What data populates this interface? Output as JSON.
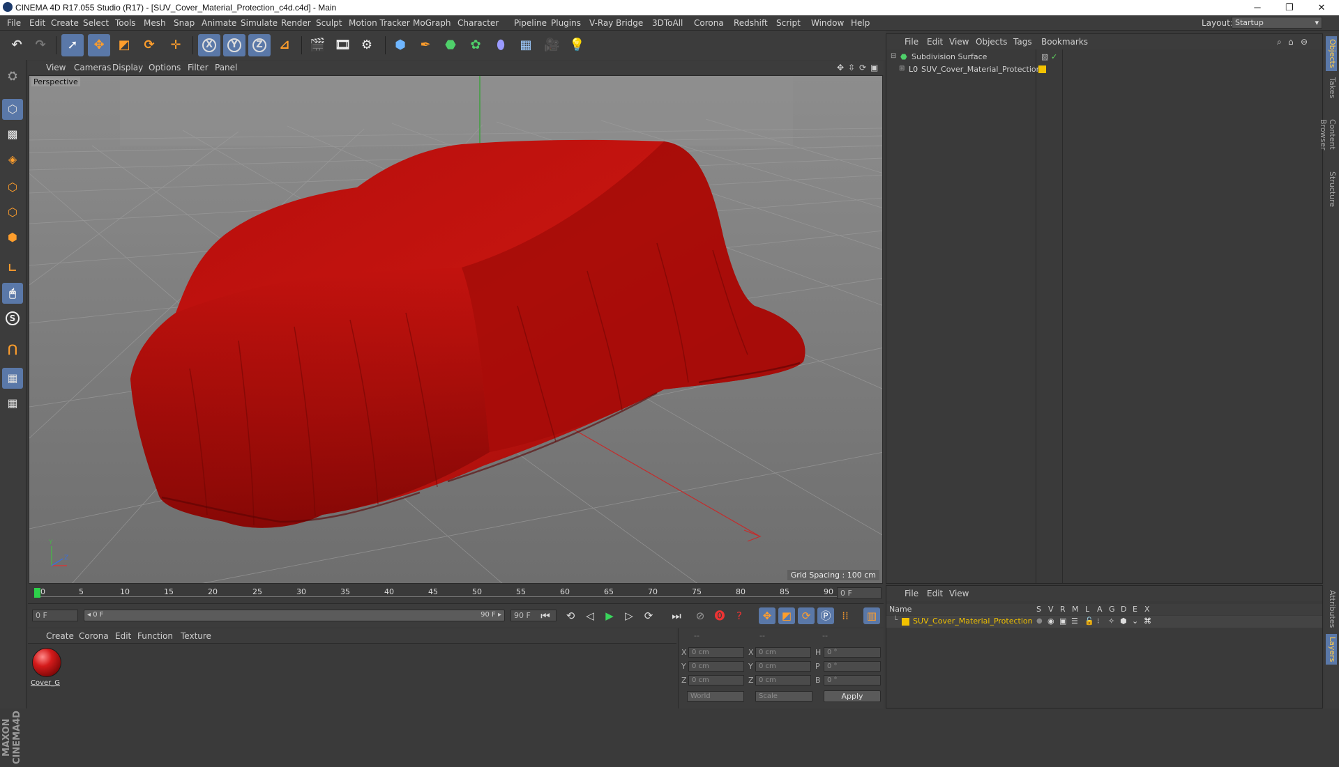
{
  "window": {
    "title": "CINEMA 4D R17.055 Studio (R17) - [SUV_Cover_Material_Protection_c4d.c4d] - Main",
    "minimize": "─",
    "restore": "❐",
    "close": "✕"
  },
  "menubar": {
    "items": [
      "File",
      "Edit",
      "Create",
      "Select",
      "Tools",
      "Mesh",
      "Snap",
      "Animate",
      "Simulate",
      "Render",
      "Sculpt",
      "Motion Tracker",
      "MoGraph",
      "Character",
      "Pipeline",
      "Plugins",
      "V-Ray Bridge",
      "3DToAll",
      "Corona",
      "Redshift",
      "Script",
      "Window",
      "Help"
    ],
    "layout_label": "Layout:",
    "layout_value": "Startup"
  },
  "toolbar": {
    "axis_x": "X",
    "axis_y": "Y",
    "axis_z": "Z"
  },
  "viewport": {
    "menu": [
      "View",
      "Cameras",
      "Display",
      "Options",
      "Filter",
      "Panel"
    ],
    "label": "Perspective",
    "grid_spacing": "Grid Spacing : 100 cm",
    "axis_y": "Y",
    "axis_z": "Z",
    "cloth_color": "#c4100d"
  },
  "timeline": {
    "ticks": [
      "0",
      "5",
      "10",
      "15",
      "20",
      "25",
      "30",
      "35",
      "40",
      "45",
      "50",
      "55",
      "60",
      "65",
      "70",
      "75",
      "80",
      "85",
      "90"
    ],
    "current_frame": "0 F",
    "start_field": "0 F",
    "range_start": "◂ 0 F",
    "range_end": "90 F ▸",
    "end_field": "90 F"
  },
  "material_manager": {
    "menu": [
      "Create",
      "Corona",
      "Edit",
      "Function",
      "Texture"
    ],
    "material_name": "Cover_G"
  },
  "coordinates": {
    "headers": [
      "--",
      "--",
      "--"
    ],
    "pos_labels": [
      "X",
      "Y",
      "Z"
    ],
    "size_labels": [
      "X",
      "Y",
      "Z"
    ],
    "rot_labels": [
      "H",
      "P",
      "B"
    ],
    "pos_values": [
      "0 cm",
      "0 cm",
      "0 cm"
    ],
    "size_values": [
      "0 cm",
      "0 cm",
      "0 cm"
    ],
    "rot_values": [
      "0 °",
      "0 °",
      "0 °"
    ],
    "mode1": "World",
    "mode2": "Scale",
    "apply": "Apply"
  },
  "object_manager": {
    "menu": [
      "File",
      "Edit",
      "View",
      "Objects",
      "Tags",
      "Bookmarks"
    ],
    "objects": [
      "Subdivision Surface",
      "SUV_Cover_Material_Protection"
    ]
  },
  "layer_manager": {
    "menu": [
      "File",
      "Edit",
      "View"
    ],
    "name_header": "Name",
    "columns": [
      "S",
      "V",
      "R",
      "M",
      "L",
      "A",
      "G",
      "D",
      "E",
      "X"
    ],
    "layer_name": "SUV_Cover_Material_Protection",
    "layer_color": "#f2c200"
  },
  "right_tabs": [
    "Objects",
    "Takes",
    "Content Browser",
    "Structure",
    "Attributes",
    "Layers"
  ],
  "branding": "MAXON CINEMA4D"
}
